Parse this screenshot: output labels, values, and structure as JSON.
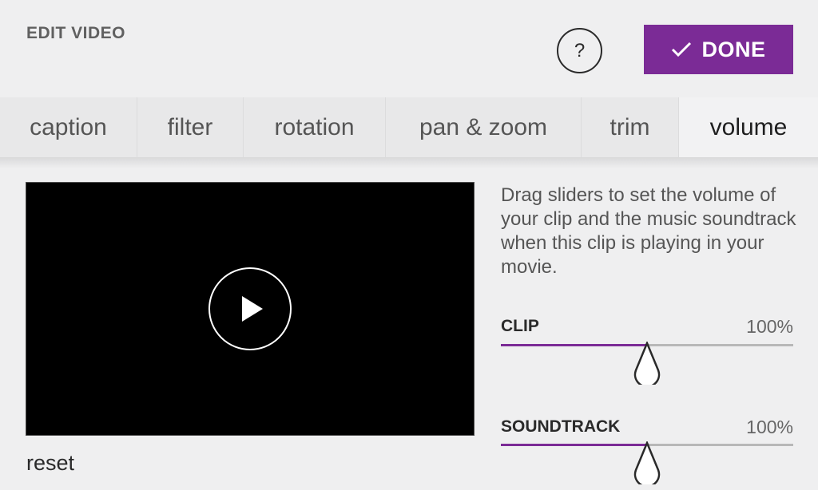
{
  "header": {
    "title": "EDIT VIDEO",
    "help_label": "?",
    "done_label": "DONE"
  },
  "tabs": [
    {
      "label": "caption",
      "active": false
    },
    {
      "label": "filter",
      "active": false
    },
    {
      "label": "rotation",
      "active": false
    },
    {
      "label": "pan & zoom",
      "active": false
    },
    {
      "label": "trim",
      "active": false
    },
    {
      "label": "volume",
      "active": true
    }
  ],
  "player": {
    "reset_label": "reset"
  },
  "volume_panel": {
    "instructions": "Drag sliders to set the volume of your clip and the music soundtrack when this clip is playing in your movie.",
    "clip": {
      "label": "CLIP",
      "value_text": "100%",
      "fill_fraction": 0.5
    },
    "soundtrack": {
      "label": "SOUNDTRACK",
      "value_text": "100%",
      "fill_fraction": 0.5
    }
  },
  "colors": {
    "accent": "#7b2b96",
    "background": "#efeff0",
    "video_bg": "#000000"
  },
  "icons": {
    "done": "check-icon",
    "play": "play-icon",
    "thumb": "slider-thumb-icon"
  }
}
